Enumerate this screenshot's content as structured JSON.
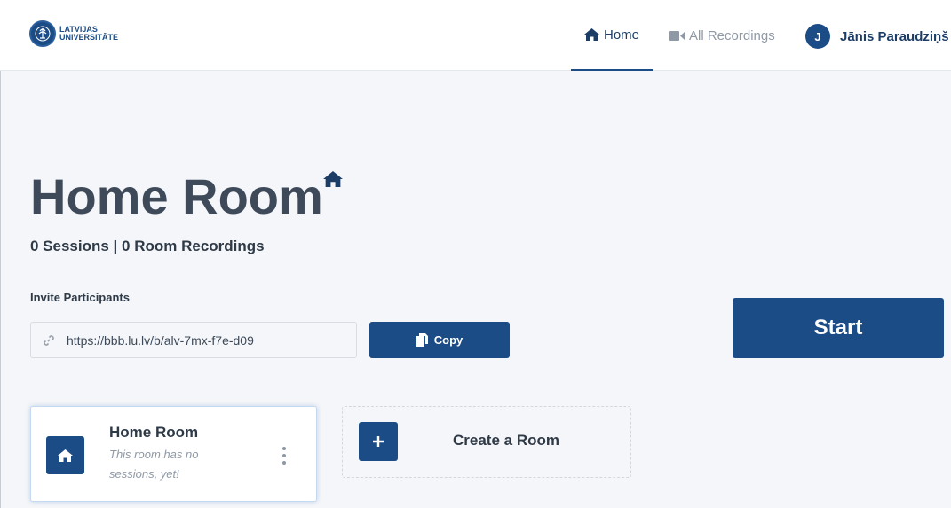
{
  "brand": {
    "logo_line1": "LATVIJAS",
    "logo_line2": "UNIVERSITĀTE"
  },
  "nav": {
    "home_label": "Home",
    "recordings_label": "All Recordings",
    "active": "home"
  },
  "user": {
    "initial": "J",
    "name": "Jānis Paraudziņš"
  },
  "room": {
    "title": "Home Room",
    "stats": "0 Sessions | 0 Room Recordings"
  },
  "invite": {
    "label": "Invite Participants",
    "url": "https://bbb.lu.lv/b/alv-7mx-f7e-d09",
    "copy_label": "Copy"
  },
  "start_label": "Start",
  "room_cards": [
    {
      "name": "Home Room",
      "subtitle": "This room has no sessions, yet!"
    }
  ],
  "create_room_label": "Create a Room",
  "colors": {
    "primary": "#1c4c86",
    "background": "#f5f6f9",
    "text": "#3e4a59",
    "muted": "#8f99a6"
  }
}
